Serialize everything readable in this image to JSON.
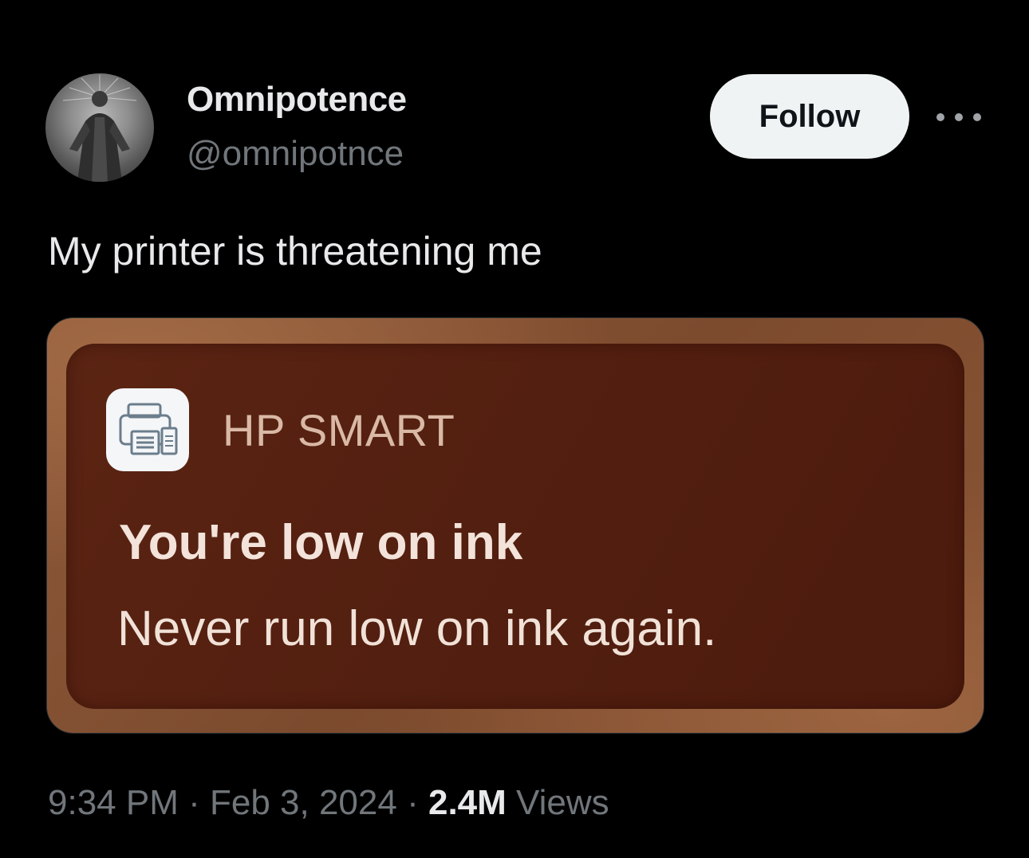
{
  "author": {
    "display_name": "Omnipotence",
    "handle": "@omnipotnce",
    "avatar_icon": "robed-figure-avatar"
  },
  "follow_label": "Follow",
  "more_icon": "more-horizontal-icon",
  "tweet": {
    "text": "My printer is threatening me"
  },
  "notification": {
    "app_icon": "printer-icon",
    "app_name": "HP SMART",
    "title": "You're low on ink",
    "body": "Never run low on ink again."
  },
  "meta": {
    "time": "9:34 PM",
    "separator": "·",
    "date": "Feb 3, 2024",
    "views_count": "2.4M",
    "views_label": "Views"
  },
  "colors": {
    "background": "#000000",
    "primary_text": "#e7e9ea",
    "secondary_text": "#71767b",
    "follow_button_bg": "#eff3f4",
    "notification_bg": "#531f10"
  }
}
